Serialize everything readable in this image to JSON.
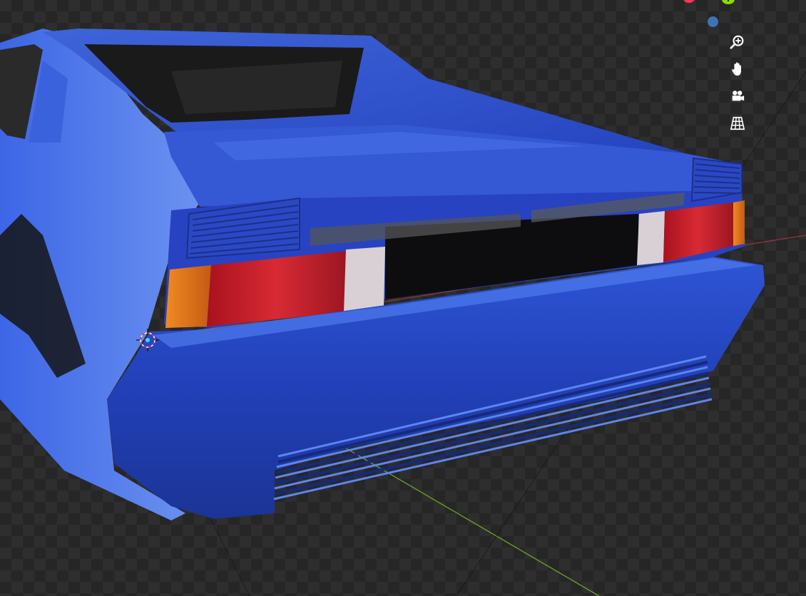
{
  "viewport": {
    "background": "#2e2e2e",
    "grid_dark": "#262626",
    "x_axis_color": "#b03a40",
    "y_axis_color": "#6a9a2a"
  },
  "gizmo": {
    "x_color": "#ff3352",
    "y_color": "#8bdc00",
    "y_label": "Y",
    "z_color": "#3d74b8"
  },
  "nav_buttons": [
    {
      "icon": "zoom-icon"
    },
    {
      "icon": "pan-hand-icon"
    },
    {
      "icon": "camera-icon"
    },
    {
      "icon": "perspective-grid-icon"
    }
  ],
  "model": {
    "body_color": "#2446c4",
    "body_highlight": "#4f7bec",
    "tail_light_red": "#c21e2a",
    "tail_light_amber": "#e0731c",
    "reverse_light": "#d8d0d4"
  }
}
